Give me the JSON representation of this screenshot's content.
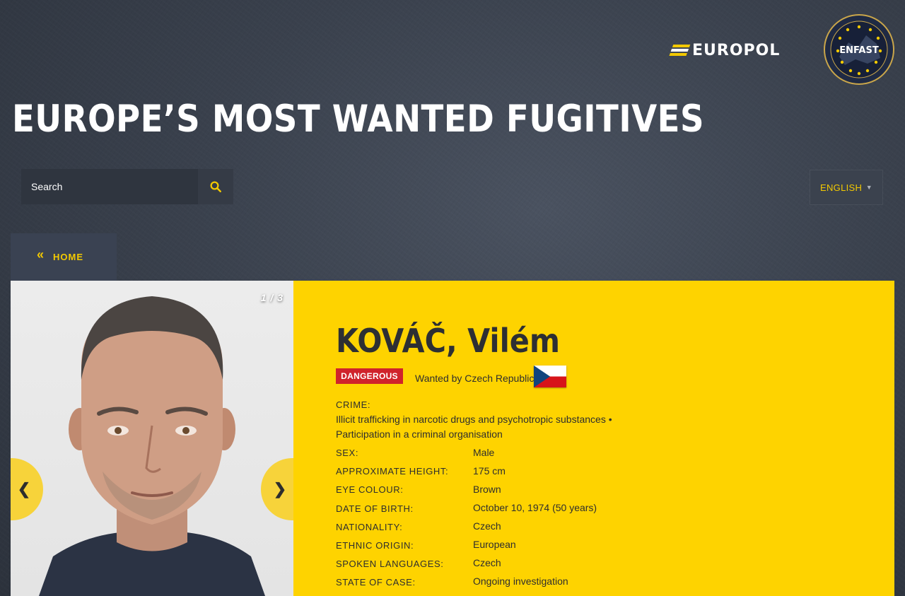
{
  "header": {
    "europol_logo": "EUROPOL",
    "enfast_logo": "ENFAST",
    "page_title": "EUROPE’S MOST WANTED FUGITIVES"
  },
  "search": {
    "placeholder": "Search",
    "icon": "search-icon"
  },
  "language": {
    "selected": "ENGLISH"
  },
  "nav": {
    "home_label": "HOME"
  },
  "gallery": {
    "counter": "1 / 3",
    "prev": "❮",
    "next": "❯"
  },
  "fugitive": {
    "name": "KOVÁČ, Vilém",
    "badge": "DANGEROUS",
    "wanted_by": "Wanted by Czech Republic",
    "crime_label": "CRIME:",
    "crime_line1": "Illicit trafficking in narcotic drugs and psychotropic substances •",
    "crime_line2": "Participation in a criminal organisation",
    "fields": [
      {
        "label": "SEX:",
        "value": "Male"
      },
      {
        "label": "APPROXIMATE HEIGHT:",
        "value": "175 cm"
      },
      {
        "label": "EYE COLOUR:",
        "value": "Brown"
      },
      {
        "label": "DATE OF BIRTH:",
        "value": "October 10, 1974 (50 years)"
      },
      {
        "label": "NATIONALITY:",
        "value": "Czech"
      },
      {
        "label": "ETHNIC ORIGIN:",
        "value": "European"
      },
      {
        "label": "SPOKEN LANGUAGES:",
        "value": "Czech"
      },
      {
        "label": "STATE OF CASE:",
        "value": "Ongoing investigation"
      }
    ]
  },
  "colors": {
    "accent_yellow": "#fed300",
    "danger_red": "#d0232b",
    "bg_dark": "#353c47"
  }
}
